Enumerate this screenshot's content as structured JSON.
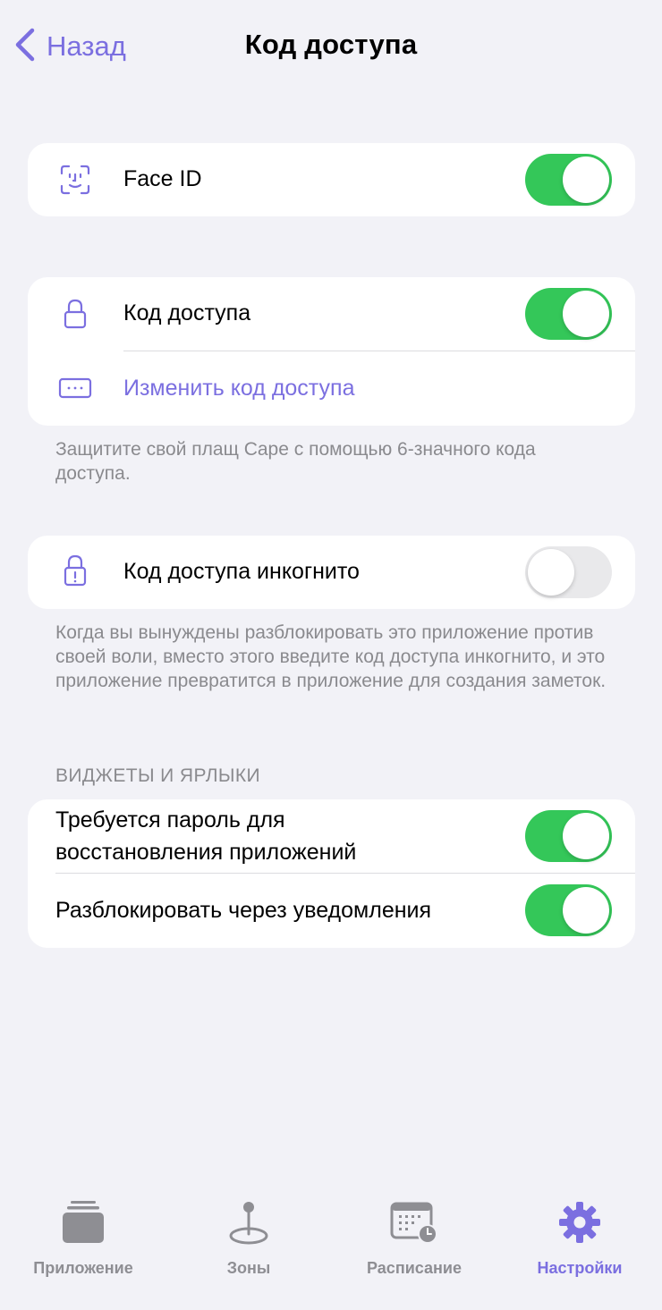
{
  "nav": {
    "back_label": "Назад",
    "title": "Код доступа"
  },
  "face_id": {
    "icon": "face-id-icon",
    "label": "Face ID",
    "toggle_on": true
  },
  "passcode": {
    "lock_icon": "lock-icon",
    "label": "Код доступа",
    "toggle_on": true,
    "change_icon": "keypad-dots-icon",
    "change_label": "Изменить код доступа",
    "footnote": "Защитите свой плащ Cape с помощью 6-значного кода доступа."
  },
  "incognito": {
    "icon": "lock-alert-icon",
    "label": "Код доступа инкогнито",
    "toggle_on": false,
    "footnote": "Когда вы вынуждены разблокировать это приложение против своей воли, вместо этого введите код доступа инкогнито, и это приложение превратится в приложение для создания заметок."
  },
  "widgets": {
    "header": "ВИДЖЕТЫ И ЯРЛЫКИ",
    "rows": [
      {
        "label_line1": "Требуется пароль для",
        "label_line2": "восстановления приложений",
        "toggle_on": true
      },
      {
        "label": "Разблокировать через уведомления",
        "toggle_on": true
      }
    ]
  },
  "tabbar": {
    "tabs": [
      {
        "label": "Приложение",
        "icon": "apps-stack-icon",
        "active": false
      },
      {
        "label": "Зоны",
        "icon": "location-pin-icon",
        "active": false
      },
      {
        "label": "Расписание",
        "icon": "calendar-clock-icon",
        "active": false
      },
      {
        "label": "Настройки",
        "icon": "gear-icon",
        "active": true
      }
    ]
  },
  "colors": {
    "accent": "#7b6fe0",
    "toggle_on": "#34c759",
    "toggle_off": "#e9e9eb",
    "background": "#f2f2f7",
    "secondary_text": "#8a8a8e"
  }
}
